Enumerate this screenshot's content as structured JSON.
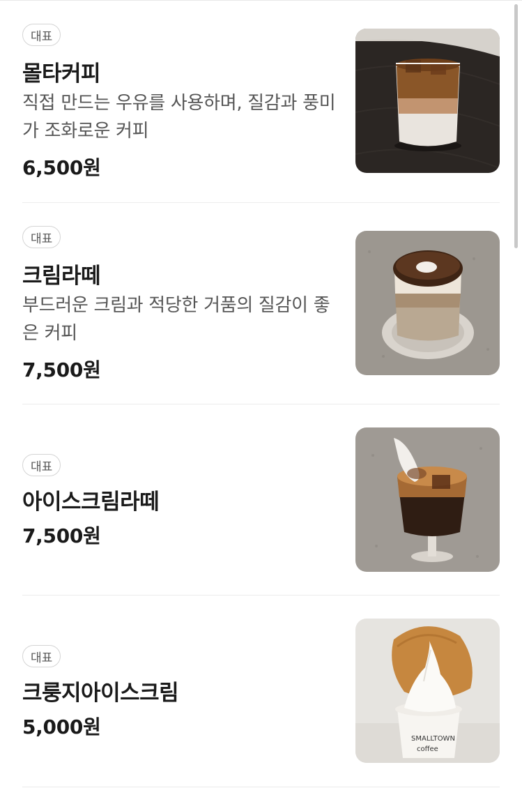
{
  "menu_items": [
    {
      "badge": "대표",
      "name": "몰타커피",
      "description": "직접 만드는 우유를 사용하며, 질감과 풍미가 조화로운 커피",
      "price": "6,500원",
      "image_icon": "iced-layered-coffee-photo"
    },
    {
      "badge": "대표",
      "name": "크림라떼",
      "description": "부드러운 크림과 적당한 거품의 질감이 좋은 커피",
      "price": "7,500원",
      "image_icon": "cream-latte-photo"
    },
    {
      "badge": "대표",
      "name": "아이스크림라떼",
      "description": "",
      "price": "7,500원",
      "image_icon": "ice-cream-latte-photo"
    },
    {
      "badge": "대표",
      "name": "크룽지아이스크림",
      "description": "",
      "price": "5,000원",
      "image_icon": "ice-cream-cup-photo"
    }
  ]
}
